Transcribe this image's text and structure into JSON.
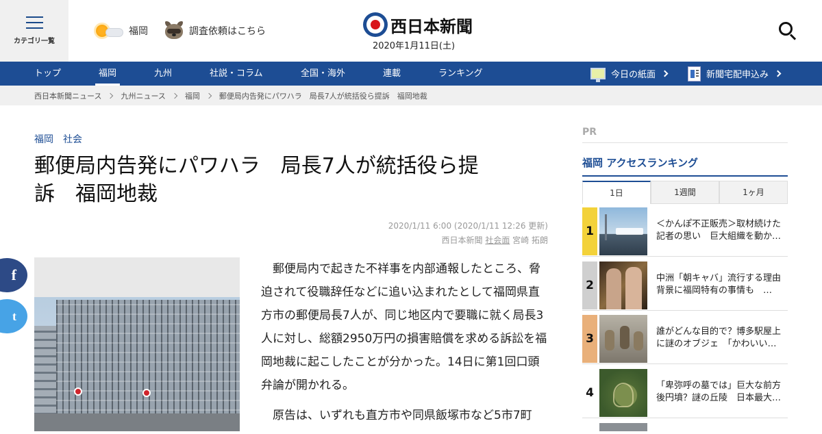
{
  "header": {
    "category_label": "カテゴリ一覧",
    "weather_location": "福岡",
    "request_label": "調査依頼はこちら",
    "logo_text": "西日本新聞",
    "date": "2020年1月11日(土)"
  },
  "nav": {
    "items": [
      {
        "label": "トップ"
      },
      {
        "label": "福岡"
      },
      {
        "label": "九州"
      },
      {
        "label": "社説・コラム"
      },
      {
        "label": "全国・海外"
      },
      {
        "label": "連載"
      },
      {
        "label": "ランキング"
      }
    ],
    "active": "福岡",
    "today_paper": "今日の紙面",
    "delivery": "新聞宅配申込み"
  },
  "breadcrumb": [
    "西日本新聞ニュース",
    "九州ニュース",
    "福岡",
    "郵便局内告発にパワハラ　局長7人が統括役ら提訴　福岡地裁"
  ],
  "article": {
    "tags": [
      "福岡",
      "社会"
    ],
    "headline_line1": "郵便局内告発にパワハラ　局長7人が統括役ら提",
    "headline_line2": "訴　福岡地裁",
    "published": "2020/1/11 6:00 (2020/1/11 12:26 更新)",
    "source": "西日本新聞",
    "section": "社会面",
    "author": "宮崎 拓朗",
    "paragraphs": [
      "郵便局内で起きた不祥事を内部通報したところ、脅迫されて役職辞任などに追い込まれたとして福岡県直方市の郵便局長7人が、同じ地区内で要職に就く局長3人に対し、総額2950万円の損害賠償を求める訴訟を福岡地裁に起こしたことが分かった。14日に第1回口頭弁論が開かれる。",
      "原告は、いずれも直方市や同県飯塚市など5市7町"
    ]
  },
  "social": {
    "facebook": "f",
    "twitter": "t"
  },
  "sidebar": {
    "pr_label": "PR",
    "ranking_title": "福岡 アクセスランキング",
    "tabs": [
      "1日",
      "1週間",
      "1ヶ月"
    ],
    "active_tab": "1日",
    "items": [
      {
        "rank": "1",
        "title": "＜かんぽ不正販売＞取材続けた記者の思い　巨大組織を動か…",
        "badge_color": "#f3d23a"
      },
      {
        "rank": "2",
        "title": "中洲「朝キャバ」流行する理由　背景に福岡特有の事情も　…",
        "badge_color": "#cfcfcf"
      },
      {
        "rank": "3",
        "title": "誰がどんな目的で？博多駅屋上に謎のオブジェ　「かわいい…",
        "badge_color": "#e9b07a"
      },
      {
        "rank": "4",
        "title": "「卑弥呼の墓では」巨大な前方後円墳？謎の丘陵　日本最大…",
        "badge_color": "#ffffff"
      }
    ]
  },
  "colors": {
    "brand_blue": "#1d4d94",
    "logo_red": "#d8141b"
  }
}
